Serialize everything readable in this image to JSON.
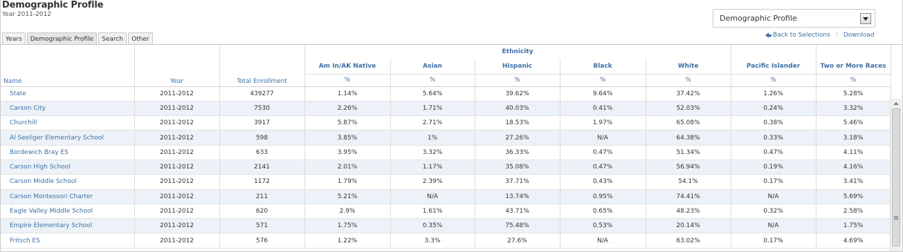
{
  "page": {
    "title": "Demographic Profile",
    "subtitle": "Year 2011-2012"
  },
  "tabs": [
    {
      "label": "Years"
    },
    {
      "label": "Demographic Profile"
    },
    {
      "label": "Search"
    },
    {
      "label": "Other"
    }
  ],
  "dropdown": {
    "selected": "Demographic Profile"
  },
  "links": {
    "back": "Back to Selections",
    "download": "Download"
  },
  "table": {
    "group_header": "Ethnicity",
    "col_name": "Name",
    "col_year": "Year",
    "col_enrollment": "Total Enrollment",
    "ethnicities": [
      "Am In/AK Native",
      "Asian",
      "Hispanic",
      "Black",
      "White",
      "Pacific Islander",
      "Two or More Races"
    ],
    "pct_label": "%",
    "rows": [
      {
        "name": "State",
        "year": "2011-2012",
        "enrollment": "439277",
        "values": [
          "1.14%",
          "5.64%",
          "39.62%",
          "9.64%",
          "37.42%",
          "1.26%",
          "5.28%"
        ]
      },
      {
        "name": "Carson City",
        "year": "2011-2012",
        "enrollment": "7530",
        "values": [
          "2.26%",
          "1.71%",
          "40.03%",
          "0.41%",
          "52.03%",
          "0.24%",
          "3.32%"
        ]
      },
      {
        "name": "Churchill",
        "year": "2011-2012",
        "enrollment": "3917",
        "values": [
          "5.87%",
          "2.71%",
          "18.53%",
          "1.97%",
          "65.08%",
          "0.38%",
          "5.46%"
        ]
      },
      {
        "name": "Al Seeliger Elementary School",
        "year": "2011-2012",
        "enrollment": "598",
        "values": [
          "3.85%",
          "1%",
          "27.26%",
          "N/A",
          "64.38%",
          "0.33%",
          "3.18%"
        ]
      },
      {
        "name": "Bordewich Bray ES",
        "year": "2011-2012",
        "enrollment": "633",
        "values": [
          "3.95%",
          "3.32%",
          "36.33%",
          "0.47%",
          "51.34%",
          "0.47%",
          "4.11%"
        ]
      },
      {
        "name": "Carson High School",
        "year": "2011-2012",
        "enrollment": "2141",
        "values": [
          "2.01%",
          "1.17%",
          "35.08%",
          "0.47%",
          "56.94%",
          "0.19%",
          "4.16%"
        ]
      },
      {
        "name": "Carson Middle School",
        "year": "2011-2012",
        "enrollment": "1172",
        "values": [
          "1.79%",
          "2.39%",
          "37.71%",
          "0.43%",
          "54.1%",
          "0.17%",
          "3.41%"
        ]
      },
      {
        "name": "Carson Montessori Charter",
        "year": "2011-2012",
        "enrollment": "211",
        "values": [
          "5.21%",
          "N/A",
          "13.74%",
          "0.95%",
          "74.41%",
          "N/A",
          "5.69%"
        ]
      },
      {
        "name": "Eagle Valley Middle School",
        "year": "2011-2012",
        "enrollment": "620",
        "values": [
          "2.9%",
          "1.61%",
          "43.71%",
          "0.65%",
          "48.23%",
          "0.32%",
          "2.58%"
        ]
      },
      {
        "name": "Empire Elementary School",
        "year": "2011-2012",
        "enrollment": "571",
        "values": [
          "1.75%",
          "0.35%",
          "75.48%",
          "0.53%",
          "20.14%",
          "N/A",
          "1.75%"
        ]
      },
      {
        "name": "Fritsch ES",
        "year": "2011-2012",
        "enrollment": "576",
        "values": [
          "1.22%",
          "3.3%",
          "27.6%",
          "N/A",
          "63.02%",
          "0.17%",
          "4.69%"
        ]
      }
    ]
  },
  "colors": {
    "link": "#3d6fa5",
    "stripe": "#ecf2f7"
  }
}
